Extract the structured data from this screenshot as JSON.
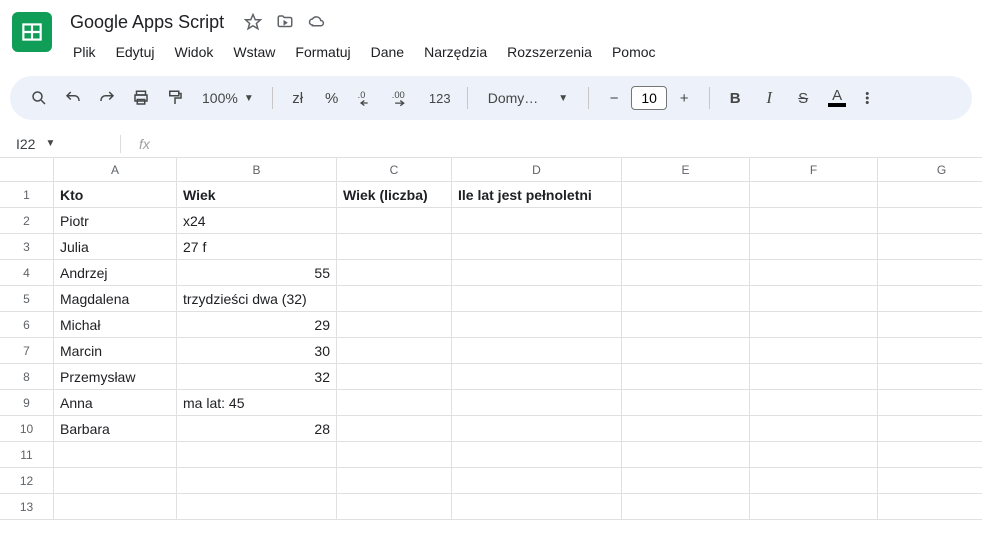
{
  "doc_title": "Google Apps Script",
  "menus": [
    "Plik",
    "Edytuj",
    "Widok",
    "Wstaw",
    "Formatuj",
    "Dane",
    "Narzędzia",
    "Rozszerzenia",
    "Pomoc"
  ],
  "toolbar": {
    "zoom": "100%",
    "currency": "zł",
    "percent": "%",
    "dec_minus": ".0",
    "dec_plus": ".00",
    "num_fmt": "123",
    "font": "Domy…",
    "font_size": "10"
  },
  "namebox": "I22",
  "columns": [
    "A",
    "B",
    "C",
    "D",
    "E",
    "F",
    "G"
  ],
  "rows": [
    {
      "n": "1",
      "a": "Kto",
      "b": "Wiek",
      "c": "Wiek (liczba)",
      "d": "Ile lat jest pełnoletni",
      "bold": true
    },
    {
      "n": "2",
      "a": "Piotr",
      "b": "x24"
    },
    {
      "n": "3",
      "a": "Julia",
      "b": "27   f"
    },
    {
      "n": "4",
      "a": "Andrzej",
      "b": "55",
      "bnum": true
    },
    {
      "n": "5",
      "a": "Magdalena",
      "b": "trzydzieści dwa (32)"
    },
    {
      "n": "6",
      "a": "Michał",
      "b": "29",
      "bnum": true
    },
    {
      "n": "7",
      "a": "Marcin",
      "b": "30",
      "bnum": true
    },
    {
      "n": "8",
      "a": "Przemysław",
      "b": "32",
      "bnum": true
    },
    {
      "n": "9",
      "a": "Anna",
      "b": "ma lat: 45"
    },
    {
      "n": "10",
      "a": "Barbara",
      "b": "28",
      "bnum": true
    },
    {
      "n": "11"
    },
    {
      "n": "12"
    },
    {
      "n": "13"
    }
  ]
}
